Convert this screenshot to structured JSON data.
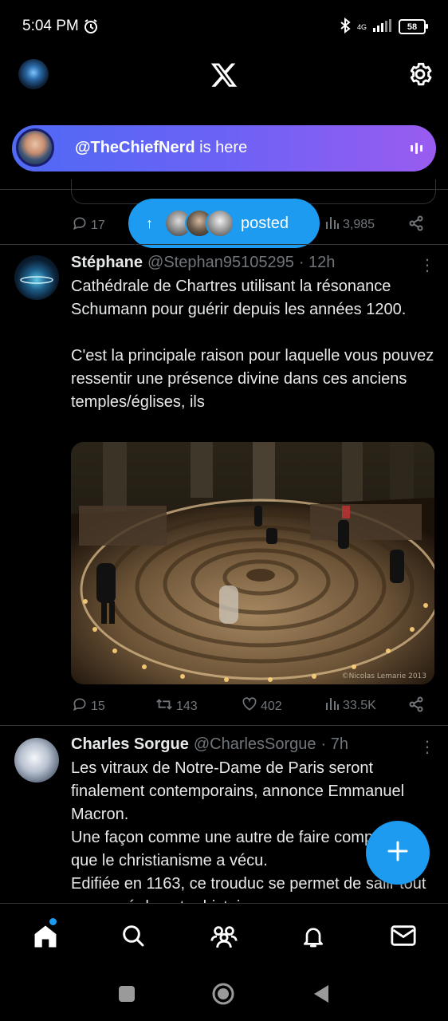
{
  "status_bar": {
    "time": "5:04 PM",
    "network": "4G",
    "battery": "58"
  },
  "spaces": {
    "handle": "@TheChiefNerd",
    "suffix": " is here"
  },
  "prev_tweet": {
    "replies": "17",
    "views": "3,985"
  },
  "posted_pill": {
    "label": "posted"
  },
  "tweets": [
    {
      "name": "Stéphane",
      "handle": "@Stephan95105295",
      "time": "· 12h",
      "text": "Cathédrale de Chartres utilisant la résonance Schumann pour guérir depuis les années 1200.\n\nC'est la principale raison pour laquelle vous pouvez ressentir une présence divine dans ces anciens temples/églises, ils",
      "media_watermark": "©Nicolas Lemarie 2013",
      "replies": "15",
      "retweets": "143",
      "likes": "402",
      "views": "33.5K"
    },
    {
      "name": "Charles Sorgue",
      "handle": "@CharlesSorgue",
      "time": "· 7h",
      "text": "Les vitraux de Notre-Dame de Paris seront finalement contemporains, annonce Emmanuel Macron.\nUne façon comme une autre de faire comprendre que le christianisme a vécu.\nEdifiée en 1163, ce trouduc se permet de salir tout un passé de notre histoire."
    }
  ],
  "icons": {
    "alarm": "alarm-icon",
    "bluetooth": "bluetooth-icon",
    "signal": "signal-icon",
    "x_logo": "x-logo-icon",
    "settings": "gear-icon",
    "home": "home-icon",
    "search": "search-icon",
    "communities": "communities-icon",
    "notifications": "bell-icon",
    "messages": "mail-icon",
    "compose": "plus-icon"
  },
  "colors": {
    "accent": "#1d9bf0",
    "spaces_start": "#4f6af5",
    "spaces_end": "#9a5cf0"
  }
}
